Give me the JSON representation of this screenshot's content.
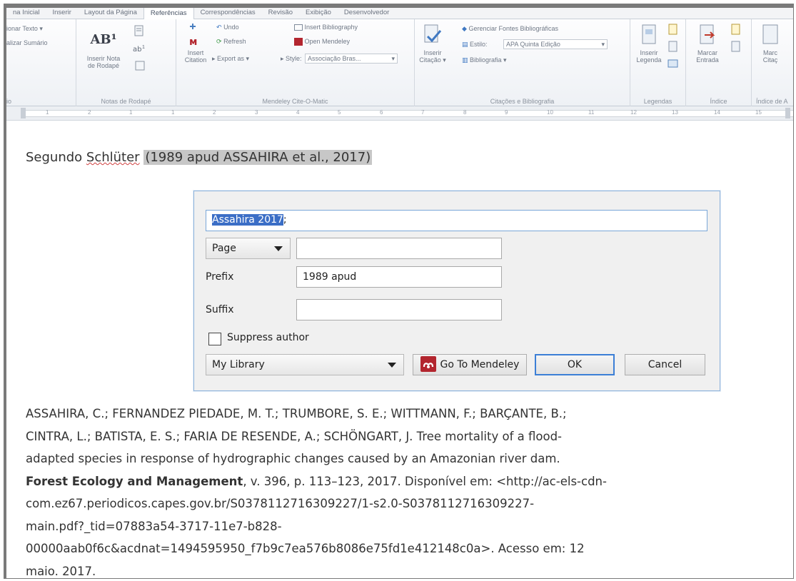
{
  "ribbon_tabs": [
    "na Inicial",
    "Inserir",
    "Layout da Página",
    "Referências",
    "Correspondências",
    "Revisão",
    "Exibição",
    "Desenvolvedor"
  ],
  "active_tab_index": 3,
  "ribbon": {
    "sumario": {
      "item1": "ionar Texto ▾",
      "item2": "alizar Sumário",
      "label": "io"
    },
    "notas": {
      "ab_glyph": "AB¹",
      "inserir_nota_line1": "Inserir Nota",
      "inserir_nota_line2": "de Rodapé",
      "label": "Notas de Rodapé"
    },
    "mendeley": {
      "insert_citation_line1": "Insert",
      "insert_citation_line2": "Citation",
      "undo": "Undo",
      "refresh": "Refresh",
      "export_as": "Export as ▾",
      "insert_bibliography": "Insert Bibliography",
      "open_mendeley": "Open Mendeley",
      "style_label": "Style:",
      "style_value": "Associação Bras...",
      "label": "Mendeley Cite-O-Matic"
    },
    "citacoes": {
      "inserir_citacao_line1": "Inserir",
      "inserir_citacao_line2": "Citação ▾",
      "gerenciar_fontes": "Gerenciar Fontes Bibliográficas",
      "estilo_label": "Estilo:",
      "estilo_value": "APA Quinta Edição",
      "bibliografia": "Bibliografia ▾",
      "label": "Citações e Bibliografia"
    },
    "legendas": {
      "inserir_legenda_line1": "Inserir",
      "inserir_legenda_line2": "Legenda",
      "label": "Legendas"
    },
    "indice": {
      "marcar_entrada_line1": "Marcar",
      "marcar_entrada_line2": "Entrada",
      "label": "Índice"
    },
    "indice_autoridades": {
      "item_line1": "Marc",
      "item_line2": "Citaç",
      "label": "Índice de A"
    }
  },
  "ruler_numbers": [
    "1",
    "2",
    "1",
    "1",
    "2",
    "3",
    "4",
    "5",
    "6",
    "7",
    "8",
    "9",
    "10",
    "11",
    "12",
    "13",
    "14",
    "15"
  ],
  "document": {
    "line_prefix": "Segundo ",
    "line_name": "Schlüter",
    "line_space": " ",
    "line_citation": "(1989 apud ASSAHIRA et al., 2017)",
    "reference_lines": [
      "ASSAHIRA, C.; FERNANDEZ PIEDADE, M. T.; TRUMBORE, S. E.; WITTMANN, F.; BARÇANTE, B.;",
      "CINTRA, L.; BATISTA, E. S.; FARIA DE RESENDE, A.; SCHÖNGART, J. Tree mortality of a flood-",
      "adapted species in response of hydrographic changes caused by an Amazonian river dam."
    ],
    "reference_journal": "Forest Ecology and Management",
    "reference_journal_rest": ", v. 396, p. 113–123, 2017. Disponível em: <http://ac-els-cdn-",
    "reference_tail_lines": [
      "com.ez67.periodicos.capes.gov.br/S0378112716309227/1-s2.0-S0378112716309227-",
      "main.pdf?_tid=07883a54-3717-11e7-b828-",
      "00000aab0f6c&acdnat=1494595950_f7b9c7ea576b8086e75fd1e412148c0a>. Acesso em: 12",
      "maio. 2017."
    ]
  },
  "dialog": {
    "citation_selected": "Assahira 2017",
    "citation_rest": ";",
    "locator_type": "Page",
    "locator_value": "",
    "prefix_label": "Prefix",
    "prefix_value": "1989 apud",
    "suffix_label": "Suffix",
    "suffix_value": "",
    "suppress_author_label": "Suppress author",
    "suppress_author_checked": false,
    "library": "My Library",
    "go_to_mendeley": "Go To Mendeley",
    "ok": "OK",
    "cancel": "Cancel"
  },
  "colors": {
    "mendeley_red": "#b3262f",
    "selection_blue": "#3b6ec6",
    "dialog_border": "#8fb4dc",
    "citation_highlight": "#c7c7c7"
  }
}
